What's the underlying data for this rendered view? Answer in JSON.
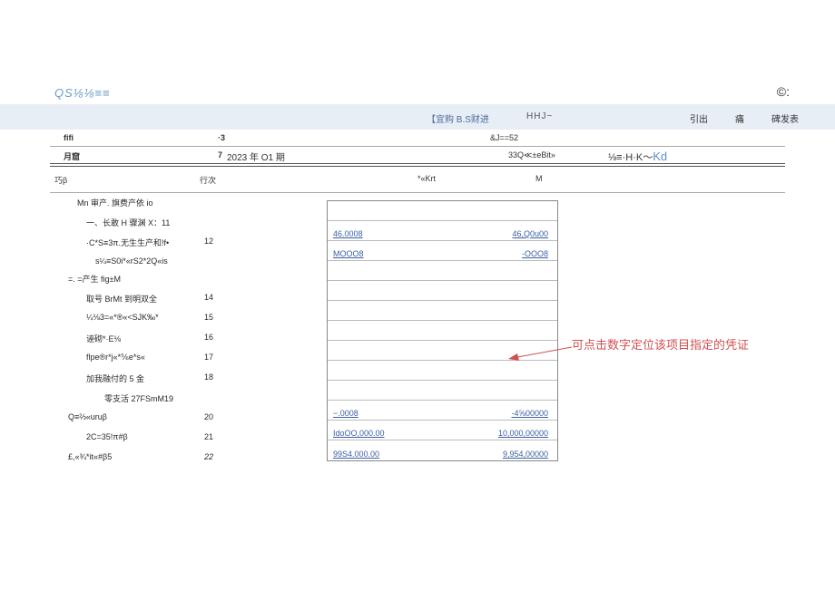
{
  "title": "QS⅛⅛≡≡",
  "corner_mark": "©:",
  "header": {
    "btn1": "【宜购 B.S财进",
    "btn2": "HHJ~",
    "btn3": "引出",
    "btn4": "痛",
    "btn5": "碑发表"
  },
  "meta1": {
    "left": "fifi",
    "mid": "·3",
    "right": "&J==52"
  },
  "meta2": {
    "left": "月窟",
    "num": "7",
    "period": "2023 年 O1 期",
    "code": "33Q≪±eBit»",
    "right_prefix": "⅛≡·H·K～",
    "right_kd": "Kd"
  },
  "cols": {
    "c1": "巧β",
    "c2": "行次",
    "c3": "*«Krt",
    "c4": "M"
  },
  "rows": [
    {
      "name": "Mn 审产. 旗费产依 io",
      "num": "",
      "indent": 1
    },
    {
      "name": "一、长敢 H 骤渊 X：11",
      "num": "",
      "indent": 2
    },
    {
      "name": "·C*S≡3π.无生生产和!f•",
      "num": "12",
      "indent": 2
    },
    {
      "name": "s¼≡S0i*«rS2*2Q«is",
      "num": "",
      "indent": 3,
      "sub": true
    },
    {
      "name": "=. =产生 fig±M",
      "num": "",
      "indent": 0
    },
    {
      "name": "取号 BrMt 到明双全",
      "num": "14",
      "indent": 2
    },
    {
      "name": "¼⅛3=«*®«<SJK‰*",
      "num": "15",
      "indent": 2
    },
    {
      "name": "诬砌*·E⅛",
      "num": "16",
      "indent": 2
    },
    {
      "name": "flpe®r*j«*⅚e*s«",
      "num": "17",
      "indent": 2
    },
    {
      "name": "加我融付的 5 金",
      "num": "18",
      "indent": 2
    },
    {
      "name": "零支活 27FSmM19",
      "num": "",
      "indent": 4
    },
    {
      "name": "Q≡⅔«uruβ",
      "num": "20",
      "indent": 0
    },
    {
      "name": "2C=35!π#β",
      "num": "21",
      "indent": 2
    },
    {
      "name": "£,«¾*it«#β5",
      "num": "22",
      "indent": 0,
      "italic": true
    }
  ],
  "numbox": [
    {
      "a": "",
      "b": ""
    },
    {
      "a": "46.0008",
      "b": "46,Q0u00"
    },
    {
      "a": "MOOO8",
      "b": "-OOO8"
    },
    {
      "a": "",
      "b": ""
    },
    {
      "a": "",
      "b": ""
    },
    {
      "a": "",
      "b": ""
    },
    {
      "a": "",
      "b": ""
    },
    {
      "a": "",
      "b": ""
    },
    {
      "a": "",
      "b": ""
    },
    {
      "a": "",
      "b": ""
    },
    {
      "a": "−.0008",
      "b": "-4⅝00000"
    },
    {
      "a": "IdoOO,000.00",
      "b": "10,000,00000"
    },
    {
      "a": "99S4.000.00",
      "b": "9,954,00000"
    }
  ],
  "annotation": "可点击数字定位该项目指定的凭证"
}
